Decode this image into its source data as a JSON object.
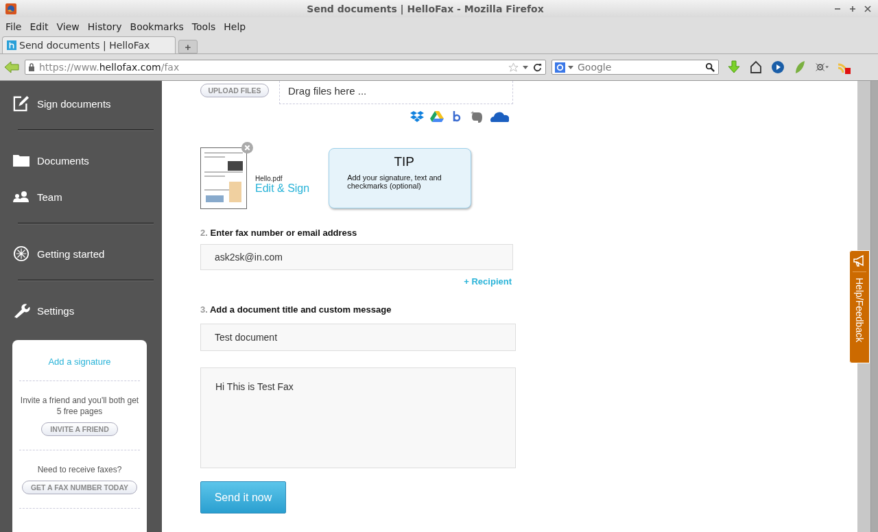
{
  "window": {
    "title": "Send documents | HelloFax - Mozilla Firefox"
  },
  "menu": [
    "File",
    "Edit",
    "View",
    "History",
    "Bookmarks",
    "Tools",
    "Help"
  ],
  "tabs": [
    {
      "label": "Send documents | HelloFax",
      "selected": true
    }
  ],
  "new_tab": "+",
  "address": {
    "prefix": "https://www.",
    "domain": "hellofax.com",
    "path": "/fax"
  },
  "search": {
    "placeholder": "Google"
  },
  "sidebar": {
    "groups": [
      [
        {
          "label": "Sign documents",
          "kind": "sign"
        }
      ],
      [
        {
          "label": "Documents",
          "kind": "folder"
        },
        {
          "label": "Team",
          "kind": "team"
        }
      ],
      [
        {
          "label": "Getting started",
          "kind": "compass"
        }
      ],
      [
        {
          "label": "Settings",
          "kind": "wrench"
        }
      ]
    ],
    "card": {
      "link": "Add a signature",
      "invite_text": "Invite a friend and you'll both get 5 free pages",
      "invite_button": "INVITE A FRIEND",
      "fax_text": "Need to receive faxes?",
      "fax_button": "GET A FAX NUMBER TODAY"
    }
  },
  "upload": {
    "button": "UPLOAD FILES",
    "drop_hint": "Drag files here ..."
  },
  "file": {
    "name": "Hello.pdf",
    "action": "Edit & Sign"
  },
  "tip": {
    "title": "TIP",
    "text": "Add your signature, text and checkmarks (optional)"
  },
  "step2": {
    "number": "2.",
    "label": "Enter fax number or email address",
    "value": "ask2sk@in.com",
    "add": "+ Recipient"
  },
  "step3": {
    "number": "3.",
    "label": "Add a document title and custom message",
    "title_value": "Test document",
    "message_value": "Hi This is Test Fax"
  },
  "send_button": "Send it now",
  "feedback_tab": "Help/Feedback"
}
